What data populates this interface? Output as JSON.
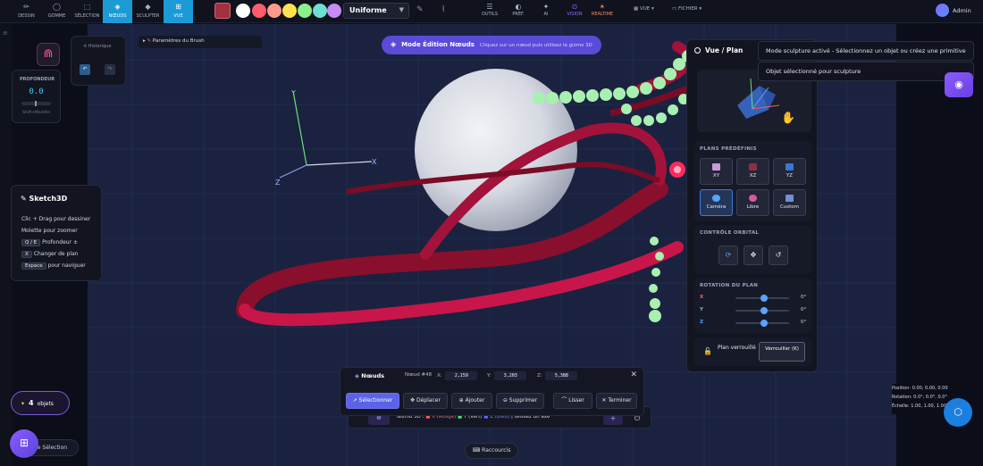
{
  "toolbar": {
    "tools": [
      {
        "label": "DESSIN",
        "icon": "pencil-icon",
        "glyph": "✏"
      },
      {
        "label": "GOMME",
        "icon": "eraser-icon",
        "glyph": "◯"
      },
      {
        "label": "SÉLECTION",
        "icon": "select-icon",
        "glyph": "⬚"
      },
      {
        "label": "NŒUDS",
        "icon": "nodes-icon",
        "glyph": "◈"
      },
      {
        "label": "SCULPTER",
        "icon": "sculpt-icon",
        "glyph": "◆"
      },
      {
        "label": "VUE",
        "icon": "view-icon",
        "glyph": "⊞"
      }
    ],
    "active_tools": [
      "NŒUDS",
      "VUE"
    ],
    "selected_color": "#a3303e",
    "colors": [
      "#ffffff",
      "#ff5c6e",
      "#ff9a8a",
      "#ffe34d",
      "#8cf08a",
      "#6de0d2",
      "#c58cf5"
    ],
    "brush_mode": "Uniforme",
    "right_tools": [
      {
        "label": "OUTILS",
        "icon": "tools-icon",
        "glyph": "☰"
      },
      {
        "label": "PRÉF.",
        "icon": "preferences-icon",
        "glyph": "◐"
      },
      {
        "label": "AI",
        "icon": "ai-icon",
        "glyph": "✦"
      },
      {
        "label": "VISION",
        "icon": "vision-icon",
        "glyph": "⊙"
      },
      {
        "label": "REALTIME",
        "icon": "realtime-icon",
        "glyph": "✴"
      }
    ],
    "menu_view": "VUE",
    "menu_file": "FICHIER",
    "user": "Admin"
  },
  "left": {
    "depth_title": "PROFONDEUR",
    "depth_value": "0.0",
    "depth_hint": "Shift+Molette",
    "history_title": "Historique",
    "brush_params": "Paramètres du Brush"
  },
  "help": {
    "title": "Sketch3D",
    "lines": [
      {
        "key": "",
        "text": "Clic + Drag pour dessiner"
      },
      {
        "key": "",
        "text": "Molette pour zoomer"
      },
      {
        "key": "Q / E",
        "text": "Profondeur ±"
      },
      {
        "key": "X",
        "text": "Changer de plan"
      },
      {
        "key": "Espace",
        "text": "pour naviguer"
      }
    ]
  },
  "objects": {
    "count": "4",
    "label": "objets"
  },
  "selection_pill": "de Sélection",
  "mode_banner": {
    "title": "Mode Édition Nœuds",
    "subtitle": "Cliquez sur un nœud puis utilisez le gizmo 3D"
  },
  "axes": {
    "x": "X",
    "y": "Y",
    "z": "Z"
  },
  "view_panel": {
    "title": "Vue / Plan",
    "planes_title": "PLANS PRÉDÉFINIS",
    "planes": [
      {
        "label": "XY",
        "color": "#c99bd8"
      },
      {
        "label": "XZ",
        "color": "#8a3044"
      },
      {
        "label": "YZ",
        "color": "#3b76d6"
      },
      {
        "label": "Caméra",
        "color": "#5aa3ff"
      },
      {
        "label": "Libre",
        "color": "#d65aa3"
      },
      {
        "label": "Custom",
        "color": "#6f8fd6"
      }
    ],
    "orbit_title": "CONTRÔLE ORBITAL",
    "rotation_title": "ROTATION DU PLAN",
    "rotation": [
      {
        "axis": "X",
        "value": "0°",
        "color": "#ff5a5a"
      },
      {
        "axis": "Y",
        "value": "0°",
        "color": "#5adf6a"
      },
      {
        "axis": "Z",
        "value": "0°",
        "color": "#5aa3ff"
      }
    ],
    "rotation_values": [
      0,
      0,
      0
    ],
    "lock_text": "Plan verrouillé",
    "lock_button": "Verrouiller (K)"
  },
  "tooltips": {
    "sculpt": "Mode sculpture activé - Sélectionnez un objet ou créez une primitive",
    "selected": "Objet sélectionné pour sculpture"
  },
  "node_toolbar": {
    "title": "Nœuds",
    "node_id": "Nœud #48",
    "x": "2,159",
    "y": "3,203",
    "z": "5,388",
    "buttons": [
      "Sélectionner",
      "Déplacer",
      "Ajouter",
      "Supprimer",
      "Lisser",
      "Terminer"
    ]
  },
  "gizmo": {
    "label": "Gizmo 3D :",
    "x": "X (Rouge)",
    "y": "Y (Vert)",
    "z": "Z (Bleu)",
    "hint": "| Glissez un axe"
  },
  "shortcuts": "Raccourcis",
  "transform": {
    "position": "Position: 0.00, 0.00, 0.00",
    "rotation": "Rotation: 0.0°, 0.0°, 0.0°",
    "scale": "Échelle: 1.00, 1.00, 1.00"
  }
}
